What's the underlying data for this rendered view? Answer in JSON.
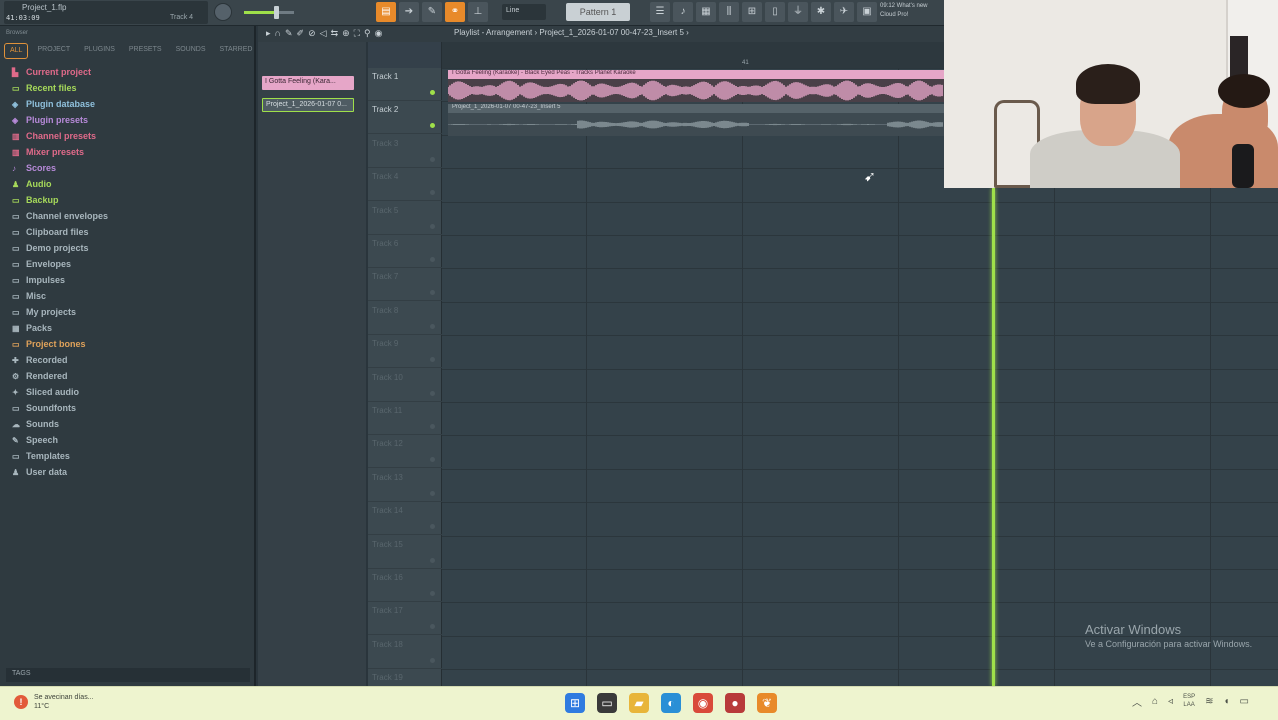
{
  "topbar": {
    "project_name": "Project_1.flp",
    "time": "41:03:09",
    "track_hint": "Track 4",
    "snap": "Line",
    "pattern": "Pattern 1",
    "news_line1": "09:12  What's new",
    "news_line2": "Cloud Pro!"
  },
  "browser": {
    "header": "Browser",
    "tabs": [
      "ALL",
      "PROJECT",
      "PLUGINS",
      "PRESETS",
      "SOUNDS",
      "STARRED"
    ],
    "items": [
      {
        "label": "Current project",
        "icon": "project-icon",
        "color": "pink"
      },
      {
        "label": "Recent files",
        "icon": "folder-icon",
        "color": "green"
      },
      {
        "label": "Plugin database",
        "icon": "plugin-icon",
        "color": "blue"
      },
      {
        "label": "Plugin presets",
        "icon": "plugin-icon",
        "color": "purple"
      },
      {
        "label": "Channel presets",
        "icon": "preset-icon",
        "color": "pink"
      },
      {
        "label": "Mixer presets",
        "icon": "preset-icon",
        "color": "pink"
      },
      {
        "label": "Scores",
        "icon": "note-icon",
        "color": "purple"
      },
      {
        "label": "Audio",
        "icon": "user-icon",
        "color": "green"
      },
      {
        "label": "Backup",
        "icon": "folder-icon",
        "color": "green"
      },
      {
        "label": "Channel envelopes",
        "icon": "folder-icon",
        "color": "gray"
      },
      {
        "label": "Clipboard files",
        "icon": "folder-icon",
        "color": "gray"
      },
      {
        "label": "Demo projects",
        "icon": "folder-icon",
        "color": "gray"
      },
      {
        "label": "Envelopes",
        "icon": "folder-icon",
        "color": "gray"
      },
      {
        "label": "Impulses",
        "icon": "folder-icon",
        "color": "gray"
      },
      {
        "label": "Misc",
        "icon": "folder-icon",
        "color": "gray"
      },
      {
        "label": "My projects",
        "icon": "folder-icon",
        "color": "gray"
      },
      {
        "label": "Packs",
        "icon": "pack-icon",
        "color": "gray"
      },
      {
        "label": "Project bones",
        "icon": "folder-icon",
        "color": "orange"
      },
      {
        "label": "Recorded",
        "icon": "record-icon",
        "color": "gray"
      },
      {
        "label": "Rendered",
        "icon": "render-icon",
        "color": "gray"
      },
      {
        "label": "Sliced audio",
        "icon": "slice-icon",
        "color": "gray"
      },
      {
        "label": "Soundfonts",
        "icon": "folder-icon",
        "color": "gray"
      },
      {
        "label": "Sounds",
        "icon": "cloud-icon",
        "color": "gray"
      },
      {
        "label": "Speech",
        "icon": "speech-icon",
        "color": "gray"
      },
      {
        "label": "Templates",
        "icon": "folder-icon",
        "color": "gray"
      },
      {
        "label": "User data",
        "icon": "user-icon",
        "color": "gray"
      }
    ],
    "tags_label": "TAGS"
  },
  "playlist": {
    "title": "Playlist - Arrangement › Project_1_2026-01-07 00-47-23_Insert 5 ›",
    "ruler_mark": "41",
    "picker_clips": [
      "I Gotta Feeling (Kara...",
      "Project_1_2026-01-07 0..."
    ],
    "tracks": [
      "Track 1",
      "Track 2",
      "Track 3",
      "Track 4",
      "Track 5",
      "Track 6",
      "Track 7",
      "Track 8",
      "Track 9",
      "Track 10",
      "Track 11",
      "Track 12",
      "Track 13",
      "Track 14",
      "Track 15",
      "Track 16",
      "Track 17",
      "Track 18",
      "Track 19"
    ],
    "clip1_label": "I Gotta Feeling (Karaoke) - Black Eyed Peas - Tracks Planet Karaoke",
    "clip2_label": "Project_1_2026-01-07 00-47-23_Insert 5"
  },
  "watermark": {
    "title": "Activar Windows",
    "subtitle": "Ve a Configuración para activar Windows."
  },
  "taskbar": {
    "weather_line1": "Se avecinan días...",
    "weather_line2": "11°C",
    "lang_line1": "ESP",
    "lang_line2": "LAA"
  },
  "colors": {
    "accent_green": "#9fe04a",
    "accent_orange": "#e88a2a",
    "clip_pink": "#e6a6c8"
  }
}
